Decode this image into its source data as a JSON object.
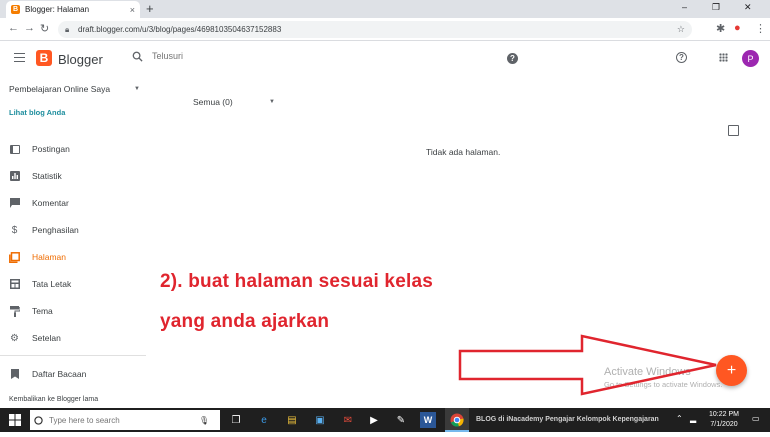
{
  "browser": {
    "tab_title": "Blogger: Halaman",
    "tab_close": "×",
    "new_tab": "+",
    "url": "draft.blogger.com/u/3/blog/pages/4698103504637152883",
    "window_controls": [
      "–",
      "❐",
      "✕"
    ]
  },
  "header": {
    "app_name": "Blogger",
    "logo_letter": "B",
    "search_placeholder": "Telusuri",
    "help_glyph": "?",
    "avatar_letter": "P"
  },
  "sidebar": {
    "blog_name": "Pembelajaran Online Saya",
    "view_blog": "Lihat blog Anda",
    "items": [
      {
        "label": "Postingan",
        "icon": "posts-icon",
        "active": false
      },
      {
        "label": "Statistik",
        "icon": "stats-icon",
        "active": false
      },
      {
        "label": "Komentar",
        "icon": "comment-icon",
        "active": false
      },
      {
        "label": "Penghasilan",
        "icon": "dollar-icon",
        "active": false
      },
      {
        "label": "Halaman",
        "icon": "pages-icon",
        "active": true
      },
      {
        "label": "Tata Letak",
        "icon": "layout-icon",
        "active": false
      },
      {
        "label": "Tema",
        "icon": "paint-roller-icon",
        "active": false
      },
      {
        "label": "Setelan",
        "icon": "gear-icon",
        "active": false
      }
    ],
    "reading_list": "Daftar Bacaan",
    "old_blogger": "Kembalikan ke Blogger lama"
  },
  "main": {
    "filter": "Semua (0)",
    "empty_message": "Tidak ada halaman."
  },
  "annotation": {
    "line1": "2). buat halaman sesuai kelas",
    "line2": "yang anda ajarkan"
  },
  "fab": {
    "label": "+"
  },
  "watermark": {
    "title": "Activate Windows",
    "subtitle": "Go to Settings to activate Windows."
  },
  "taskbar": {
    "search_placeholder": "Type here to search",
    "overlay_text": "BLOG di iNacademy Pengajar Kelompok Kepengajaran",
    "time": "10:22 PM",
    "date": "7/1/2020"
  },
  "colors": {
    "accent": "#ff5722",
    "active_nav": "#ef6c00",
    "annotation": "#e0252e",
    "avatar": "#9c27b0"
  }
}
